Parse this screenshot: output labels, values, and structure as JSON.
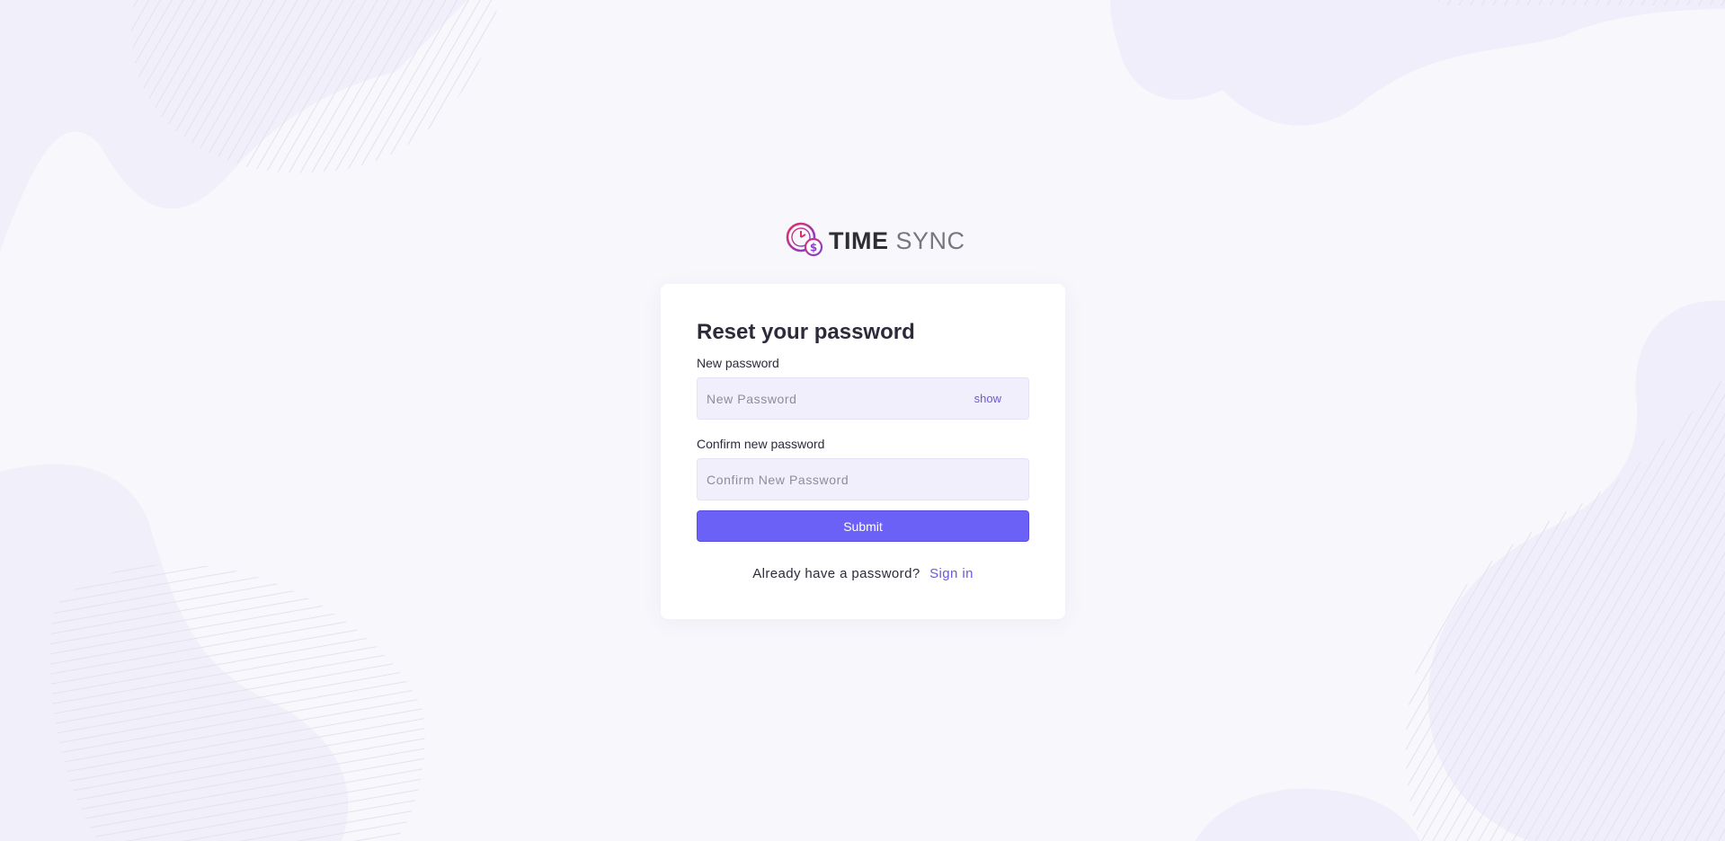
{
  "brand": {
    "logo_icon": "clock-coin-icon",
    "name_bold": "TIME",
    "name_light": "SYNC"
  },
  "reset": {
    "title": "Reset your password",
    "new_password": {
      "label": "New password",
      "placeholder": "New Password",
      "value": "",
      "toggle_label": "show"
    },
    "confirm_password": {
      "label": "Confirm new password",
      "placeholder": "Confirm New Password",
      "value": ""
    },
    "submit_label": "Submit",
    "signin_prompt": "Already have a password?",
    "signin_link": "Sign in"
  },
  "colors": {
    "accent": "#6c61f6",
    "link": "#6a5ad6",
    "background": "#f7f7fc",
    "input_bg": "#f0effb",
    "blob": "#efeffb"
  }
}
